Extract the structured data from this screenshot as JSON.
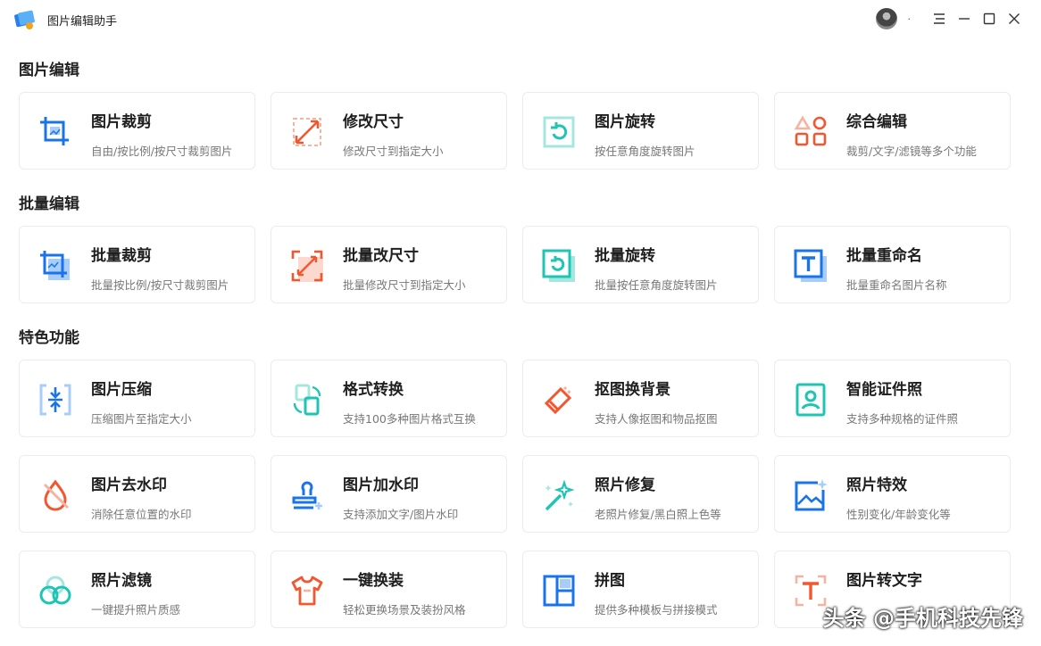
{
  "app": {
    "title": "图片编辑助手",
    "user_label": "·"
  },
  "sections": [
    {
      "title": "图片编辑",
      "cards": [
        {
          "title": "图片裁剪",
          "desc": "自由/按比例/按尺寸裁剪图片",
          "icon": "crop-icon"
        },
        {
          "title": "修改尺寸",
          "desc": "修改尺寸到指定大小",
          "icon": "resize-icon"
        },
        {
          "title": "图片旋转",
          "desc": "按任意角度旋转图片",
          "icon": "rotate-icon"
        },
        {
          "title": "综合编辑",
          "desc": "裁剪/文字/滤镜等多个功能",
          "icon": "shapes-icon"
        }
      ]
    },
    {
      "title": "批量编辑",
      "cards": [
        {
          "title": "批量裁剪",
          "desc": "批量按比例/按尺寸裁剪图片",
          "icon": "batch-crop-icon"
        },
        {
          "title": "批量改尺寸",
          "desc": "批量修改尺寸到指定大小",
          "icon": "batch-resize-icon"
        },
        {
          "title": "批量旋转",
          "desc": "批量按任意角度旋转图片",
          "icon": "batch-rotate-icon"
        },
        {
          "title": "批量重命名",
          "desc": "批量重命名图片名称",
          "icon": "rename-icon"
        }
      ]
    },
    {
      "title": "特色功能",
      "cards": [
        {
          "title": "图片压缩",
          "desc": "压缩图片至指定大小",
          "icon": "compress-icon"
        },
        {
          "title": "格式转换",
          "desc": "支持100多种图片格式互换",
          "icon": "convert-icon"
        },
        {
          "title": "抠图换背景",
          "desc": "支持人像抠图和物品抠图",
          "icon": "eraser-icon"
        },
        {
          "title": "智能证件照",
          "desc": "支持多种规格的证件照",
          "icon": "id-photo-icon"
        },
        {
          "title": "图片去水印",
          "desc": "消除任意位置的水印",
          "icon": "remove-watermark-icon"
        },
        {
          "title": "图片加水印",
          "desc": "支持添加文字/图片水印",
          "icon": "stamp-icon"
        },
        {
          "title": "照片修复",
          "desc": "老照片修复/黑白照上色等",
          "icon": "magic-wand-icon"
        },
        {
          "title": "照片特效",
          "desc": "性别变化/年龄变化等",
          "icon": "effects-icon"
        },
        {
          "title": "照片滤镜",
          "desc": "一键提升照片质感",
          "icon": "filter-icon"
        },
        {
          "title": "一键换装",
          "desc": "轻松更换场景及装扮风格",
          "icon": "shirt-icon"
        },
        {
          "title": "拼图",
          "desc": "提供多种模板与拼接模式",
          "icon": "collage-icon"
        },
        {
          "title": "图片转文字",
          "desc": "",
          "icon": "ocr-icon"
        }
      ]
    }
  ],
  "watermark": "头条 @手机科技先锋",
  "colors": {
    "blue": "#1a74e8",
    "orange": "#f4572f",
    "teal": "#1ec4b4",
    "light_blue": "#a8cdf8",
    "light_orange": "#f8b3a0",
    "light_teal": "#a4e7df"
  }
}
